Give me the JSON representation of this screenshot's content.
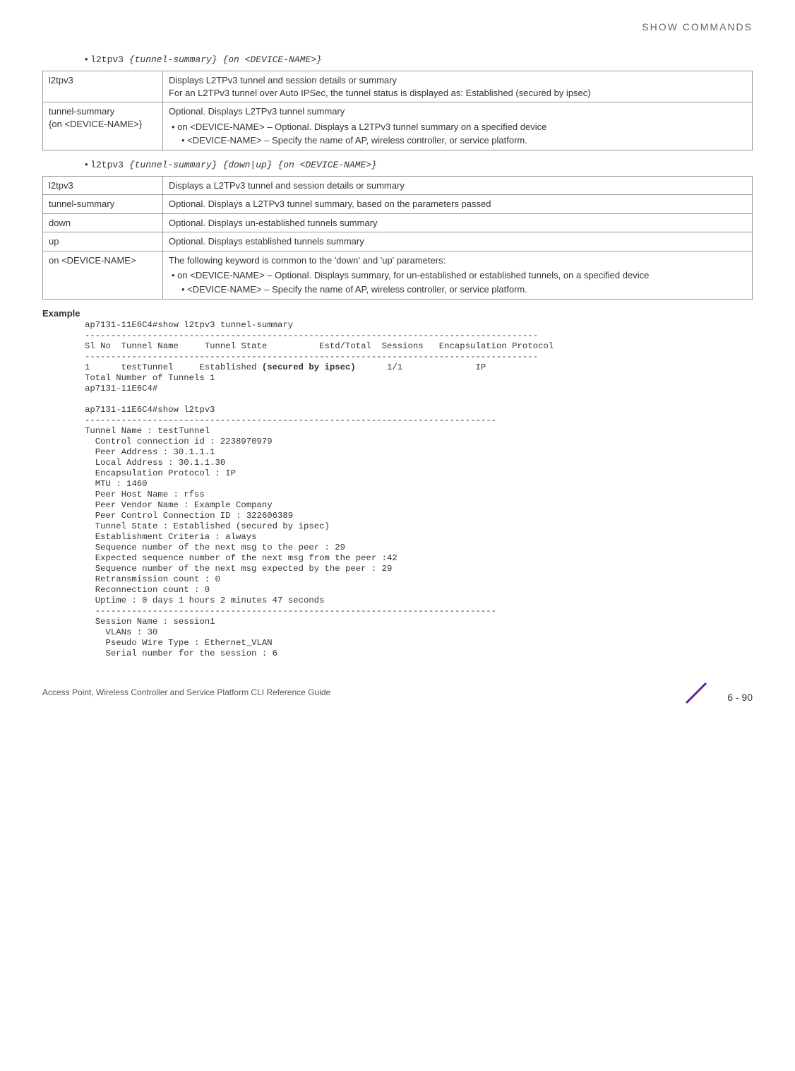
{
  "header": {
    "title": "SHOW COMMANDS"
  },
  "syntax1": {
    "cmd": "l2tpv3",
    "args": "{tunnel-summary} {on <DEVICE-NAME>}"
  },
  "table1": {
    "r0c0": "l2tpv3",
    "r0c1a": "Displays L2TPv3 tunnel and session details or summary",
    "r0c1b": "For an L2TPv3 tunnel over Auto IPSec, the tunnel status is displayed as: Established (secured by ipsec)",
    "r1c0a": "tunnel-summary",
    "r1c0b": "{on <DEVICE-NAME>}",
    "r1c1a": "Optional. Displays L2TPv3 tunnel summary",
    "r1c1b": "on <DEVICE-NAME> – Optional. Displays a L2TPv3 tunnel summary on a specified device",
    "r1c1c": "<DEVICE-NAME> – Specify the name of AP, wireless controller, or service platform."
  },
  "syntax2": {
    "cmd": "l2tpv3",
    "args": "{tunnel-summary} {down|up} {on <DEVICE-NAME>}"
  },
  "table2": {
    "r0c0": "l2tpv3",
    "r0c1": "Displays a L2TPv3 tunnel and session details or summary",
    "r1c0": "tunnel-summary",
    "r1c1": "Optional. Displays a L2TPv3 tunnel summary, based on the parameters passed",
    "r2c0": "down",
    "r2c1": "Optional. Displays un-established tunnels summary",
    "r3c0": "up",
    "r3c1": "Optional. Displays established tunnels summary",
    "r4c0": "on <DEVICE-NAME>",
    "r4c1a": "The following keyword is common to the 'down' and 'up' parameters:",
    "r4c1b": "on <DEVICE-NAME> – Optional. Displays summary, for un-established or established tunnels, on a specified device",
    "r4c1c": "<DEVICE-NAME> – Specify the name of AP, wireless controller, or service platform."
  },
  "example": {
    "label": "Example",
    "block1_pre": "ap7131-11E6C4#show l2tpv3 tunnel-summary\n---------------------------------------------------------------------------------------\nSl No  Tunnel Name     Tunnel State          Estd/Total  Sessions   Encapsulation Protocol\n---------------------------------------------------------------------------------------\n1      testTunnel     Established ",
    "block1_bold": "(secured by ipsec)",
    "block1_post": "      1/1              IP\nTotal Number of Tunnels 1\nap7131-11E6C4#\n\nap7131-11E6C4#show l2tpv3\n-------------------------------------------------------------------------------\nTunnel Name : testTunnel\n  Control connection id : 2238970979\n  Peer Address : 30.1.1.1\n  Local Address : 30.1.1.30\n  Encapsulation Protocol : IP\n  MTU : 1460\n  Peer Host Name : rfss\n  Peer Vendor Name : Example Company\n  Peer Control Connection ID : 322606389\n  Tunnel State : Established (secured by ipsec)\n  Establishment Criteria : always\n  Sequence number of the next msg to the peer : 29\n  Expected sequence number of the next msg from the peer :42\n  Sequence number of the next msg expected by the peer : 29\n  Retransmission count : 0\n  Reconnection count : 0\n  Uptime : 0 days 1 hours 2 minutes 47 seconds\n  -----------------------------------------------------------------------------\n  Session Name : session1\n    VLANs : 30\n    Pseudo Wire Type : Ethernet_VLAN\n    Serial number for the session : 6"
  },
  "footer": {
    "text": "Access Point, Wireless Controller and Service Platform CLI Reference Guide",
    "page": "6 - 90"
  }
}
